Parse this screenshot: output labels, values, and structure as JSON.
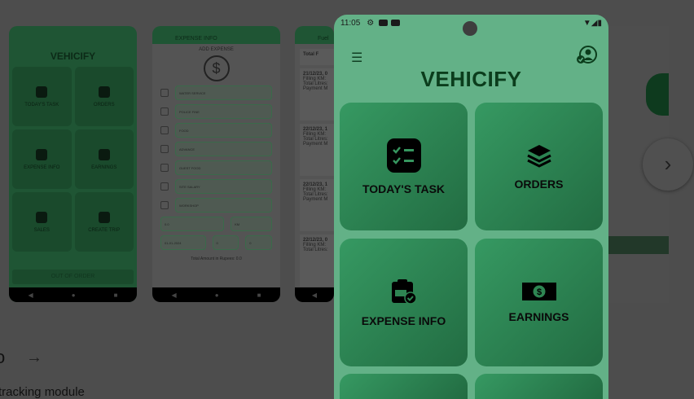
{
  "thumbnails": [
    {
      "title": "VEHICIFY",
      "tiles": [
        "TODAY'S TASK",
        "ORDERS",
        "EXPENSE INFO",
        "EARNINGS",
        "SALES",
        "CREATE TRIP"
      ],
      "footer": "OUT OF ORDER"
    },
    {
      "header": "EXPENSE INFO",
      "subtitle": "ADD EXPENSE",
      "fields": [
        "WATER SERVICE",
        "POLICE FINE",
        "FOOD",
        "ADVANCE",
        "GUEST FOOD",
        "SITE SALARY",
        "WORKSHOP"
      ],
      "amount": "0.0",
      "km": "KM",
      "date": "01-01-2024",
      "hour": "0",
      "minute": "0",
      "total": "Total Amount in Rupees: 0.0"
    },
    {
      "header": "Fuel",
      "tab": "Total F",
      "cards": [
        {
          "date": "21/12/23, 0",
          "l1": "Filling KM: ",
          "l2": "Total Litres:",
          "l3": "Payment M"
        },
        {
          "date": "22/12/23, 1",
          "l1": "Filling KM: ",
          "l2": "Total Litres:",
          "l3": "Payment M"
        },
        {
          "date": "22/12/23, 1",
          "l1": "Filling KM: ",
          "l2": "Total Litres:",
          "l3": "Payment M"
        },
        {
          "date": "22/12/23, 0",
          "l1": "Filling KM: ",
          "l2": "Total Litres:",
          "l3": ""
        }
      ]
    }
  ],
  "phone": {
    "time": "11:05",
    "title": "VEHICIFY",
    "tiles": [
      {
        "label": "TODAY'S TASK",
        "icon": "checklist-icon"
      },
      {
        "label": "ORDERS",
        "icon": "layers-icon"
      },
      {
        "label": "EXPENSE INFO",
        "icon": "clipboard-money-icon"
      },
      {
        "label": "EARNINGS",
        "icon": "dollar-bill-icon"
      }
    ]
  },
  "page": {
    "heading_fragment": "o",
    "description_fragment": "tracking module"
  },
  "colors": {
    "phone_bg": "#63b187",
    "tile": "#2e8552",
    "title": "#0b3d1c"
  }
}
